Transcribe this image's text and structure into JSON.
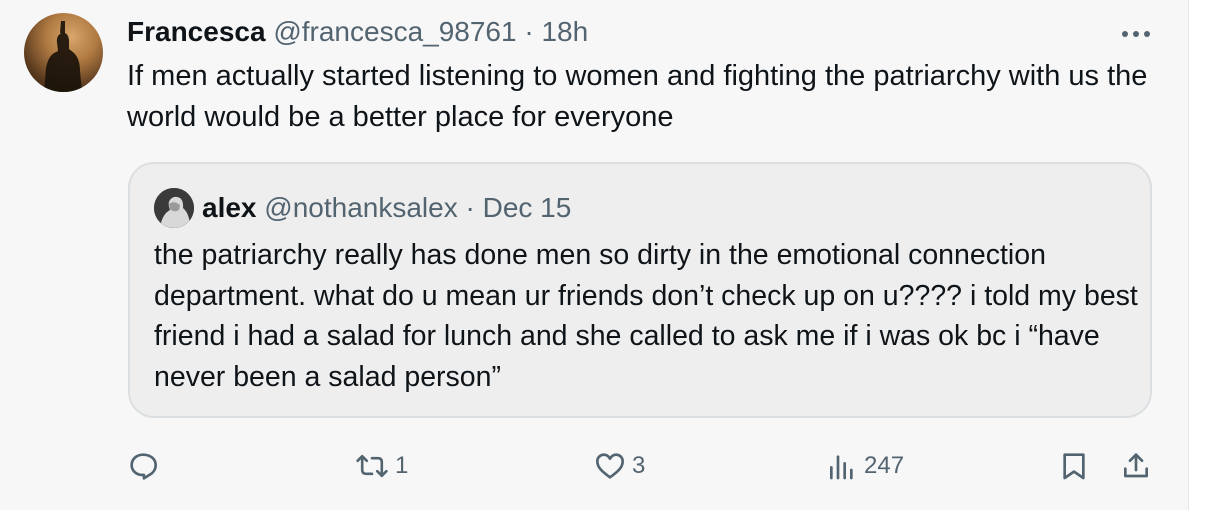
{
  "post": {
    "author_name": "Francesca",
    "handle": "@francesca_98761",
    "separator": "·",
    "time": "18h",
    "text": "If men actually started listening to women and fighting the patriarchy with us the world would be a better place for everyone"
  },
  "quote": {
    "author_name": "alex",
    "handle": "@nothanksalex",
    "separator": "·",
    "date": "Dec 15",
    "text": "the patriarchy really has done men so dirty in the emotional connection department. what do u mean ur friends don’t check up on u???? i told my best friend i had a salad for lunch and she called to ask me if i was ok bc i “have never been a salad person”"
  },
  "actions": {
    "reply_count": "",
    "repost_count": "1",
    "like_count": "3",
    "views_count": "247"
  },
  "icons": {
    "more": "more-icon",
    "reply": "reply-icon",
    "repost": "repost-icon",
    "like": "heart-icon",
    "views": "views-icon",
    "bookmark": "bookmark-icon",
    "share": "share-icon"
  },
  "colors": {
    "text_primary": "#0f1419",
    "text_secondary": "#536471",
    "background": "#f7f7f7",
    "quote_background": "#eeeeee",
    "quote_border": "#dcdfe2"
  }
}
